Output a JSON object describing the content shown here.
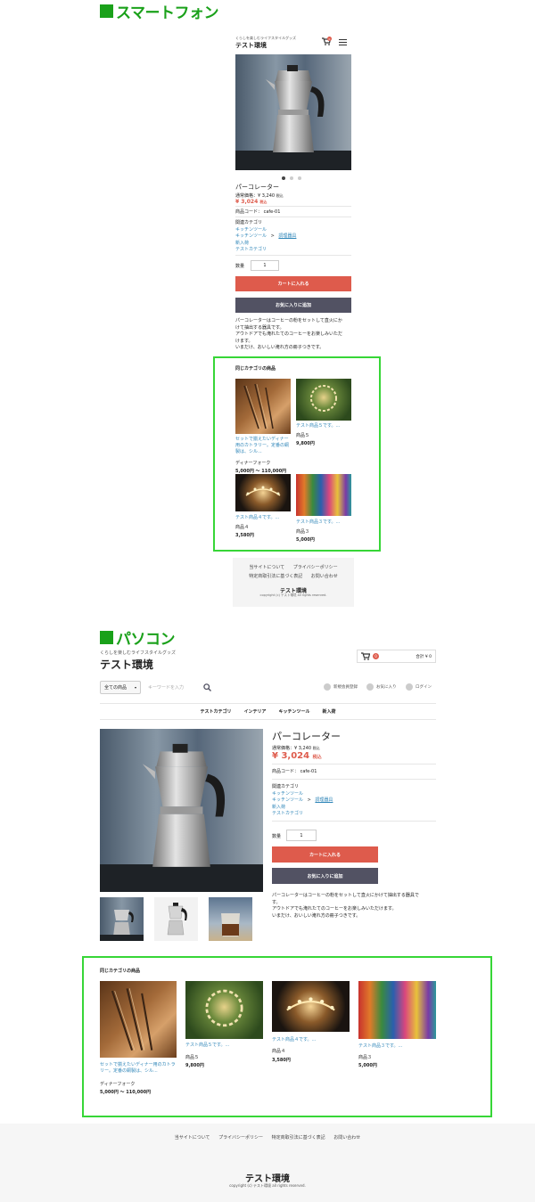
{
  "sp": {
    "heading": "スマートフォン",
    "tagline": "くらしを楽しむライフスタイルグッズ",
    "shop_name": "テスト環境",
    "cart_badge": "0",
    "product": {
      "name": "パーコレーター",
      "regular_price_label": "通常価格：¥ 3,240",
      "tax_small": "税込",
      "price": "¥ 3,024",
      "price_tax": "税込",
      "code": "商品コード： cafe-01",
      "related_label": "関連カテゴリ",
      "related": [
        "キッチンツール",
        "キッチンツール",
        "調理器具",
        "新入荷",
        "テストカテゴリ"
      ],
      "separator": ">",
      "qty_label": "数量",
      "qty_value": "1",
      "add_to_cart": "カートに入れる",
      "add_to_favorite": "お気に入りに追加",
      "description_lines": [
        "パーコレーターはコーヒーの粉をセットして直火にか",
        "けて抽出する器具です。",
        "アウトドアでも淹れたてのコーヒーをお楽しみいただ",
        "けます。",
        "いまだけ、おいしい淹れ方の冊子つきです。"
      ]
    },
    "same_category_title": "同じカテゴリの商品",
    "items": [
      {
        "title": "セットで揃えたいディナー用のカトラリー。定番の銅製は、シル...",
        "name": "ディナーフォーク",
        "price": "5,000円 ～ 110,000円"
      },
      {
        "title": "テスト商品５です。...",
        "name": "商品５",
        "price": "9,800円"
      },
      {
        "title": "テスト商品４です。...",
        "name": "商品４",
        "price": "3,580円"
      },
      {
        "title": "テスト商品３です。...",
        "name": "商品３",
        "price": "5,000円"
      }
    ],
    "footer_links": [
      "当サイトについて",
      "プライバシーポリシー",
      "特定商取引法に基づく表記",
      "お問い合わせ"
    ],
    "footer_shop": "テスト環境",
    "copyright": "copyright (c) テスト環境 all rights reserved."
  },
  "pc": {
    "heading": "パソコン",
    "tagline": "くらしを楽しむライフスタイルグッズ",
    "shop_name": "テスト環境",
    "cart_badge": "0",
    "cart_total": "合計 ¥ 0",
    "category_select": "全ての商品",
    "search_placeholder": "キーワードを入力",
    "user_links": [
      "新規会員登録",
      "お気に入り",
      "ログイン"
    ],
    "nav": [
      "テストカテゴリ",
      "インテリア",
      "キッチンツール",
      "新入荷"
    ],
    "product": {
      "name": "パーコレーター",
      "regular_price_label": "通常価格：¥ 3,240",
      "tax_small": "税込",
      "price": "¥ 3,024",
      "price_tax": "税込",
      "code": "商品コード： cafe-01",
      "related_label": "関連カテゴリ",
      "related": [
        "キッチンツール",
        "キッチンツール",
        "調理器具",
        "新入荷",
        "テストカテゴリ"
      ],
      "separator": ">",
      "qty_label": "数量",
      "qty_value": "1",
      "add_to_cart": "カートに入れる",
      "add_to_favorite": "お気に入りに追加",
      "description_lines": [
        "パーコレーターはコーヒーの粉をセットして直火にかけて抽出する器具で",
        "す。",
        "アウトドアでも淹れたてのコーヒーをお楽しみいただけます。",
        "いまだけ、おいしい淹れ方の冊子つきです。"
      ]
    },
    "same_category_title": "同じカテゴリの商品",
    "items": [
      {
        "title": "セットで揃えたいディナー用のカトラリー。定番の銅製は、シル...",
        "name": "ディナーフォーク",
        "price": "5,000円 ～ 110,000円"
      },
      {
        "title": "テスト商品５です。...",
        "name": "商品５",
        "price": "9,800円"
      },
      {
        "title": "テスト商品４です。...",
        "name": "商品４",
        "price": "3,580円"
      },
      {
        "title": "テスト商品３です。...",
        "name": "商品３",
        "price": "5,000円"
      }
    ],
    "footer_links": [
      "当サイトについて",
      "プライバシーポリシー",
      "特定商取引法に基づく表記",
      "お問い合わせ"
    ],
    "footer_shop": "テスト環境",
    "copyright": "copyright (c) テスト環境 all rights reserved."
  }
}
